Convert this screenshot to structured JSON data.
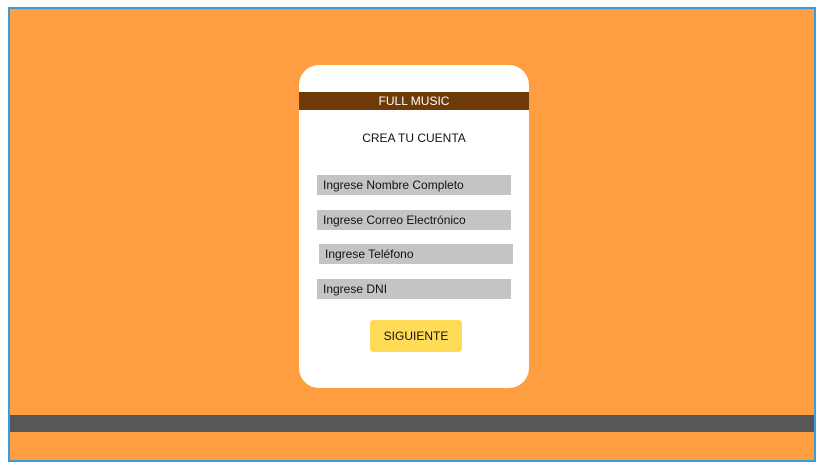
{
  "app": {
    "brand": "FULL MUSIC"
  },
  "form": {
    "title": "CREA TU CUENTA",
    "fields": {
      "full_name": {
        "placeholder": "Ingrese Nombre Completo"
      },
      "email": {
        "placeholder": "Ingrese Correo Electrónico"
      },
      "phone": {
        "placeholder": "Ingrese Teléfono"
      },
      "dni": {
        "placeholder": "Ingrese DNI"
      }
    },
    "submit_label": "SIGUIENTE"
  },
  "colors": {
    "background": "#FF9E40",
    "brand_bar": "#6E3A08",
    "field_bg": "#C4C4C4",
    "button": "#FFDB58",
    "footer_bar": "#575757",
    "frame_border": "#3A9ADB"
  }
}
